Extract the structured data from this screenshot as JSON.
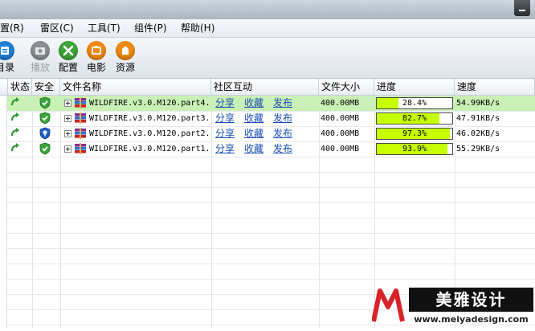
{
  "menu": {
    "items": [
      {
        "label": "设置(R)"
      },
      {
        "label": "雷区(C)"
      },
      {
        "label": "工具(T)"
      },
      {
        "label": "组件(P)"
      },
      {
        "label": "帮助(H)"
      }
    ]
  },
  "toolbar": {
    "items": [
      {
        "label": "目录",
        "icon": "directory-icon",
        "color": "#1e7fd8"
      },
      {
        "label": "播放",
        "icon": "play-icon",
        "color": "#8a9096",
        "disabled": true
      },
      {
        "label": "配置",
        "icon": "tools-icon",
        "color": "#3ea53a"
      },
      {
        "label": "电影",
        "icon": "movie-icon",
        "color": "#f08a12"
      },
      {
        "label": "资源",
        "icon": "resource-icon",
        "color": "#f08a12"
      }
    ]
  },
  "columns": {
    "status": "状态",
    "security": "安全",
    "filename": "文件名称",
    "community": "社区互动",
    "size": "文件大小",
    "progress": "进度",
    "speed": "速度"
  },
  "rows": [
    {
      "name": "WILDFIRE.v3.0.M120.part4.",
      "share": "分享",
      "favorite": "收藏",
      "publish": "发布",
      "size": "400.00MB",
      "progress": 0.284,
      "progress_text": "28.4%",
      "speed": "54.99KB/s",
      "security_icon": "shield-check-icon",
      "selected": true
    },
    {
      "name": "WILDFIRE.v3.0.M120.part3.",
      "share": "分享",
      "favorite": "收藏",
      "publish": "发布",
      "size": "400.00MB",
      "progress": 0.827,
      "progress_text": "82.7%",
      "speed": "47.91KB/s",
      "security_icon": "shield-check-icon",
      "selected": false
    },
    {
      "name": "WILDFIRE.v3.0.M120.part2.",
      "share": "分享",
      "favorite": "收藏",
      "publish": "发布",
      "size": "400.00MB",
      "progress": 0.973,
      "progress_text": "97.3%",
      "speed": "46.02KB/s",
      "security_icon": "shield-question-icon",
      "selected": false
    },
    {
      "name": "WILDFIRE.v3.0.M120.part1.",
      "share": "分享",
      "favorite": "收藏",
      "publish": "发布",
      "size": "400.00MB",
      "progress": 0.939,
      "progress_text": "93.9%",
      "speed": "55.29KB/s",
      "security_icon": "shield-check-icon",
      "selected": false
    }
  ],
  "colors": {
    "selected_row": "#c9f0b5",
    "progress_fill": "#c6ff00",
    "link": "#1b4fb3"
  },
  "watermark": {
    "brand": "美雅设计",
    "url": "www.meiyadesign.com"
  }
}
